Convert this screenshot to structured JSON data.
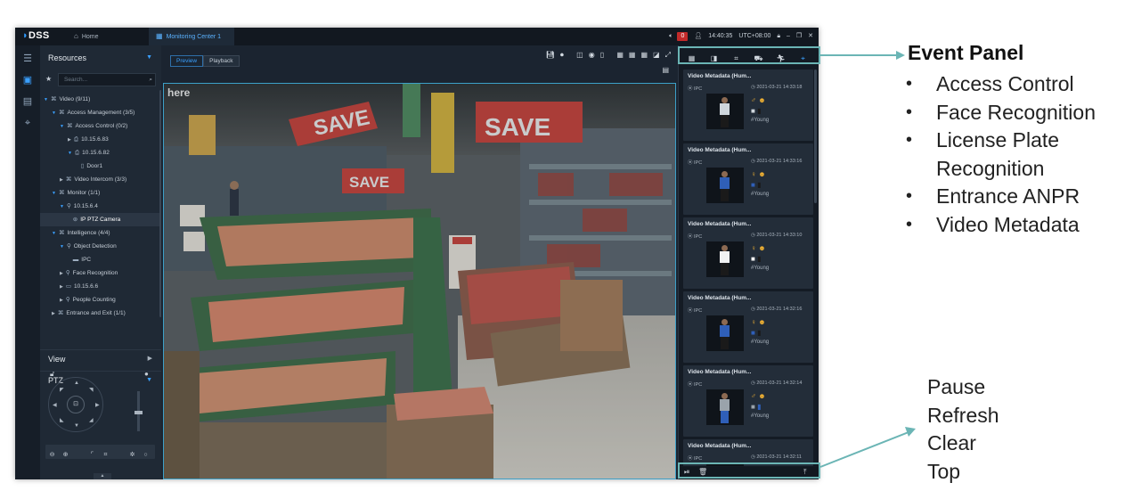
{
  "app": {
    "logo": "DSS",
    "tabs": [
      {
        "label": "Home",
        "icon": "home-icon"
      },
      {
        "label": "Monitoring Center 1",
        "icon": "grid-icon"
      }
    ],
    "alarm_count": "0",
    "time": "14:40:35",
    "timezone": "UTC+08:00"
  },
  "sidebar": {
    "title": "Resources",
    "search_placeholder": "Search...",
    "tree": [
      {
        "label": "Video (9/11)",
        "level": 0,
        "expanded": true
      },
      {
        "label": "Access Management (3/5)",
        "level": 1,
        "expanded": true
      },
      {
        "label": "Access Control (0/2)",
        "level": 2,
        "expanded": true
      },
      {
        "label": "10.15.6.83",
        "level": 3,
        "expanded": false
      },
      {
        "label": "10.15.6.82",
        "level": 3,
        "expanded": true
      },
      {
        "label": "Door1",
        "level": 4,
        "expanded": null
      },
      {
        "label": "Video Intercom (3/3)",
        "level": 2,
        "expanded": false
      },
      {
        "label": "Monitor (1/1)",
        "level": 1,
        "expanded": true
      },
      {
        "label": "10.15.6.4",
        "level": 2,
        "expanded": true
      },
      {
        "label": "IP PTZ Camera",
        "level": 3,
        "expanded": null,
        "selected": true
      },
      {
        "label": "Intelligence (4/4)",
        "level": 1,
        "expanded": true
      },
      {
        "label": "Object Detection",
        "level": 2,
        "expanded": true
      },
      {
        "label": "IPC",
        "level": 3,
        "expanded": null
      },
      {
        "label": "Face Recognition",
        "level": 2,
        "expanded": false
      },
      {
        "label": "10.15.6.6",
        "level": 2,
        "expanded": false
      },
      {
        "label": "People Counting",
        "level": 2,
        "expanded": false
      },
      {
        "label": "Entrance and Exit (1/1)",
        "level": 1,
        "expanded": false
      }
    ],
    "view_label": "View",
    "ptz_label": "PTZ"
  },
  "main": {
    "tabs": [
      "Preview",
      "Playback"
    ],
    "active_tab": "Preview",
    "overlay_text": "here",
    "scene_signs": [
      "SAVE",
      "SAVE",
      "SAVE",
      "SAVE"
    ]
  },
  "events": {
    "cards": [
      {
        "title": "Video Metadata (Hum...",
        "camera": "IPC",
        "time": "2021-03-21 14:33:18",
        "gender": "♂",
        "top_color": "#cfd6dc",
        "bottom_color": "#1a1a1a",
        "tag": "#Young"
      },
      {
        "title": "Video Metadata (Hum...",
        "camera": "IPC",
        "time": "2021-03-21 14:33:16",
        "gender": "♀",
        "top_color": "#2f5fb8",
        "bottom_color": "#1a1a1a",
        "tag": "#Young"
      },
      {
        "title": "Video Metadata (Hum...",
        "camera": "IPC",
        "time": "2021-03-21 14:33:10",
        "gender": "♀",
        "top_color": "#f2f2f2",
        "bottom_color": "#1a1a1a",
        "tag": "#Young"
      },
      {
        "title": "Video Metadata (Hum...",
        "camera": "IPC",
        "time": "2021-03-21 14:32:16",
        "gender": "♀",
        "top_color": "#2f5fb8",
        "bottom_color": "#1a1a1a",
        "tag": "#Young"
      },
      {
        "title": "Video Metadata (Hum...",
        "camera": "IPC",
        "time": "2021-03-21 14:32:14",
        "gender": "♂",
        "top_color": "#9aa3ab",
        "bottom_color": "#2f5fb8",
        "tag": "#Young"
      },
      {
        "title": "Video Metadata (Hum...",
        "camera": "IPC",
        "time": "2021-03-21 14:32:11",
        "gender": "♀",
        "top_color": "#cfd6dc",
        "bottom_color": "#1a1a1a",
        "tag": "#Young"
      }
    ]
  },
  "annotation": {
    "event_panel_title": "Event Panel",
    "event_types": [
      "Access Control",
      "Face Recognition",
      "License Plate Recognition",
      "Entrance ANPR",
      "Video Metadata"
    ],
    "controls": [
      "Pause",
      "Refresh",
      "Clear",
      "Top"
    ],
    "accent_color": "#6bb5b5"
  }
}
